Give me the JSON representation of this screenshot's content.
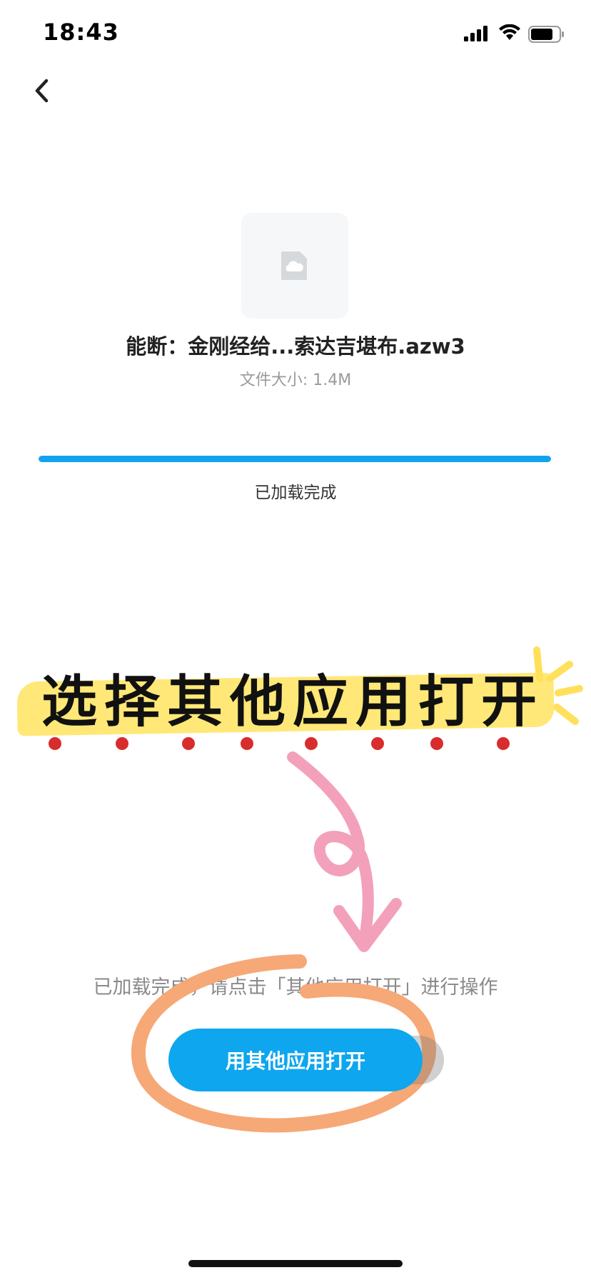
{
  "status_bar": {
    "time": "18:43",
    "signal_icon": "cellular-signal-icon",
    "wifi_icon": "wifi-icon",
    "battery_icon": "battery-icon"
  },
  "nav": {
    "back_icon": "chevron-left-icon"
  },
  "file": {
    "thumbnail_icon": "cloud-file-icon",
    "name": "能断：金刚经给...索达吉堪布.azw3",
    "size": "文件大小: 1.4M"
  },
  "progress": {
    "fraction": 1.0,
    "status": "已加载完成"
  },
  "annotation": {
    "text": "选择其他应用打开",
    "highlight_color": "#ffe877",
    "dot_color": "#d92c2c",
    "arrow_color": "#f3a0bb",
    "circle_color": "#f6a877"
  },
  "hint": "已加载完成，请点击「其他应用打开」进行操作",
  "open_button": {
    "label": "用其他应用打开",
    "color": "#0ea6ef"
  }
}
